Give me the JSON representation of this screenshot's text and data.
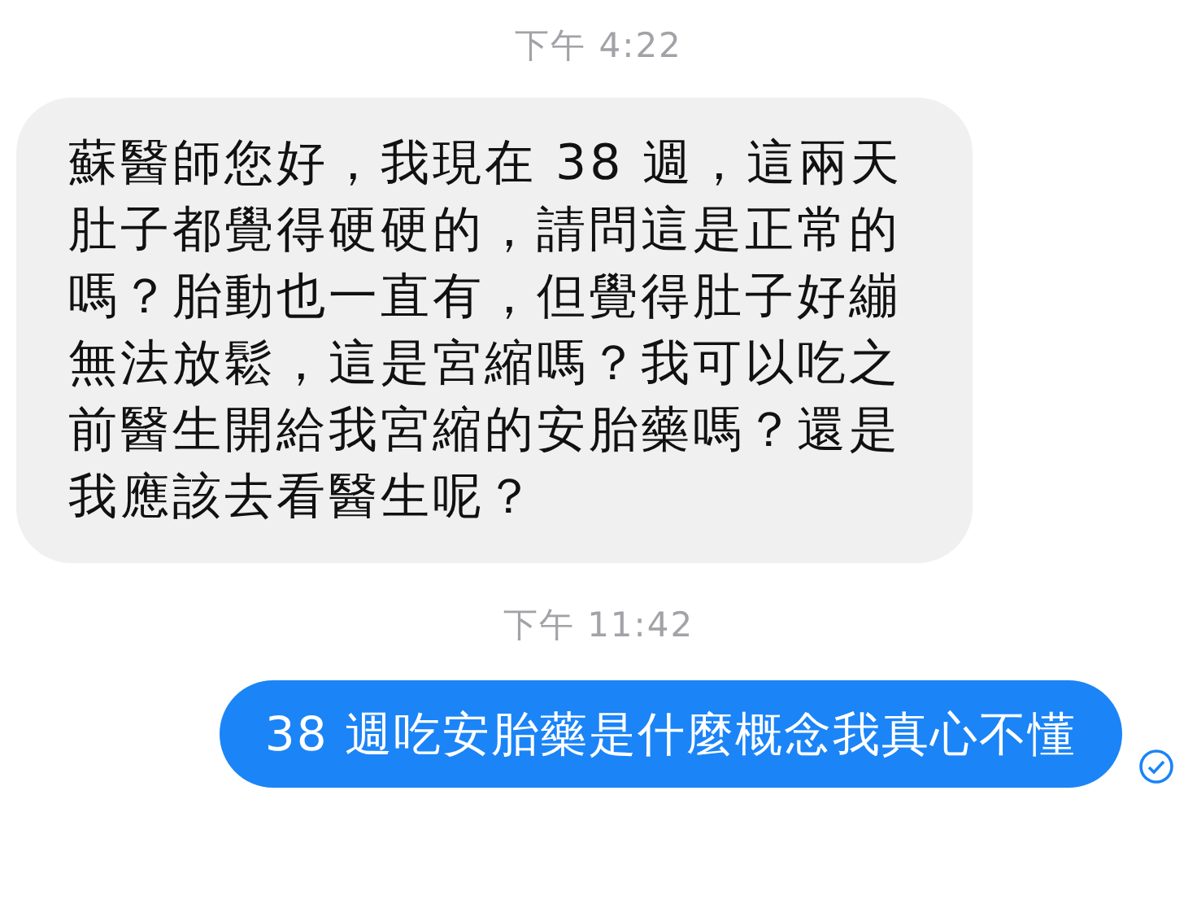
{
  "messages": [
    {
      "kind": "timestamp",
      "text": "下午 4:22"
    },
    {
      "kind": "incoming",
      "text": "蘇醫師您好，我現在 38 週，這兩天肚子都覺得硬硬的，請問這是正常的嗎？胎動也一直有，但覺得肚子好繃無法放鬆，這是宮縮嗎？我可以吃之前醫生開給我宮縮的安胎藥嗎？還是我應該去看醫生呢？"
    },
    {
      "kind": "timestamp",
      "text": "下午 11:42"
    },
    {
      "kind": "outgoing",
      "text": "38 週吃安胎藥是什麼概念我真心不懂",
      "sent": true
    }
  ]
}
